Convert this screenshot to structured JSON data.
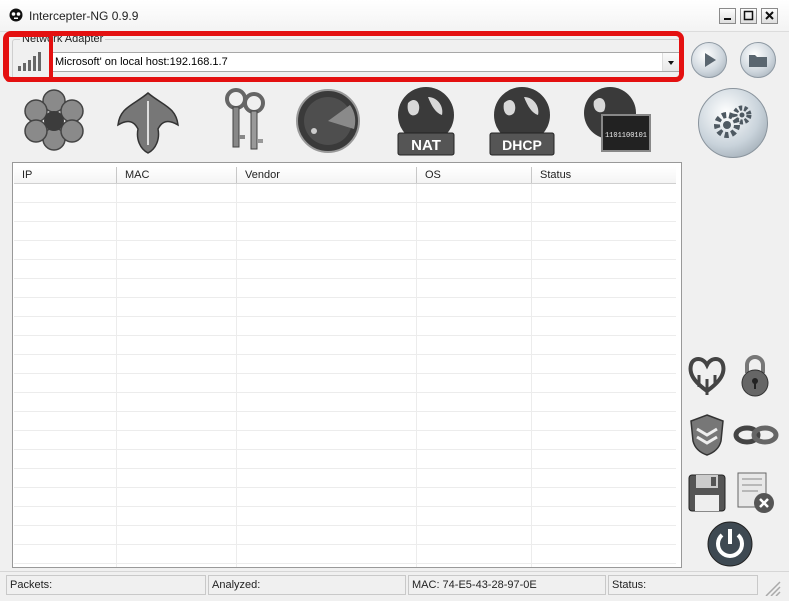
{
  "window": {
    "title": "Intercepter-NG 0.9.9",
    "controls": [
      "minimize",
      "maximize",
      "close"
    ]
  },
  "adapter": {
    "legend": "Network Adapter",
    "selected": "Microsoft' on local host:192.168.1.7"
  },
  "highlight_color": "#e41010",
  "toolbar": {
    "nat_label": "NAT",
    "dhcp_label": "DHCP",
    "binary_text": "1101100101"
  },
  "table": {
    "columns": [
      "IP",
      "MAC",
      "Vendor",
      "OS",
      "Status"
    ],
    "rows": []
  },
  "status": {
    "packets": "Packets:",
    "analyzed": "Analyzed:",
    "mac": "MAC: 74-E5-43-28-97-0E",
    "status": "Status:"
  }
}
